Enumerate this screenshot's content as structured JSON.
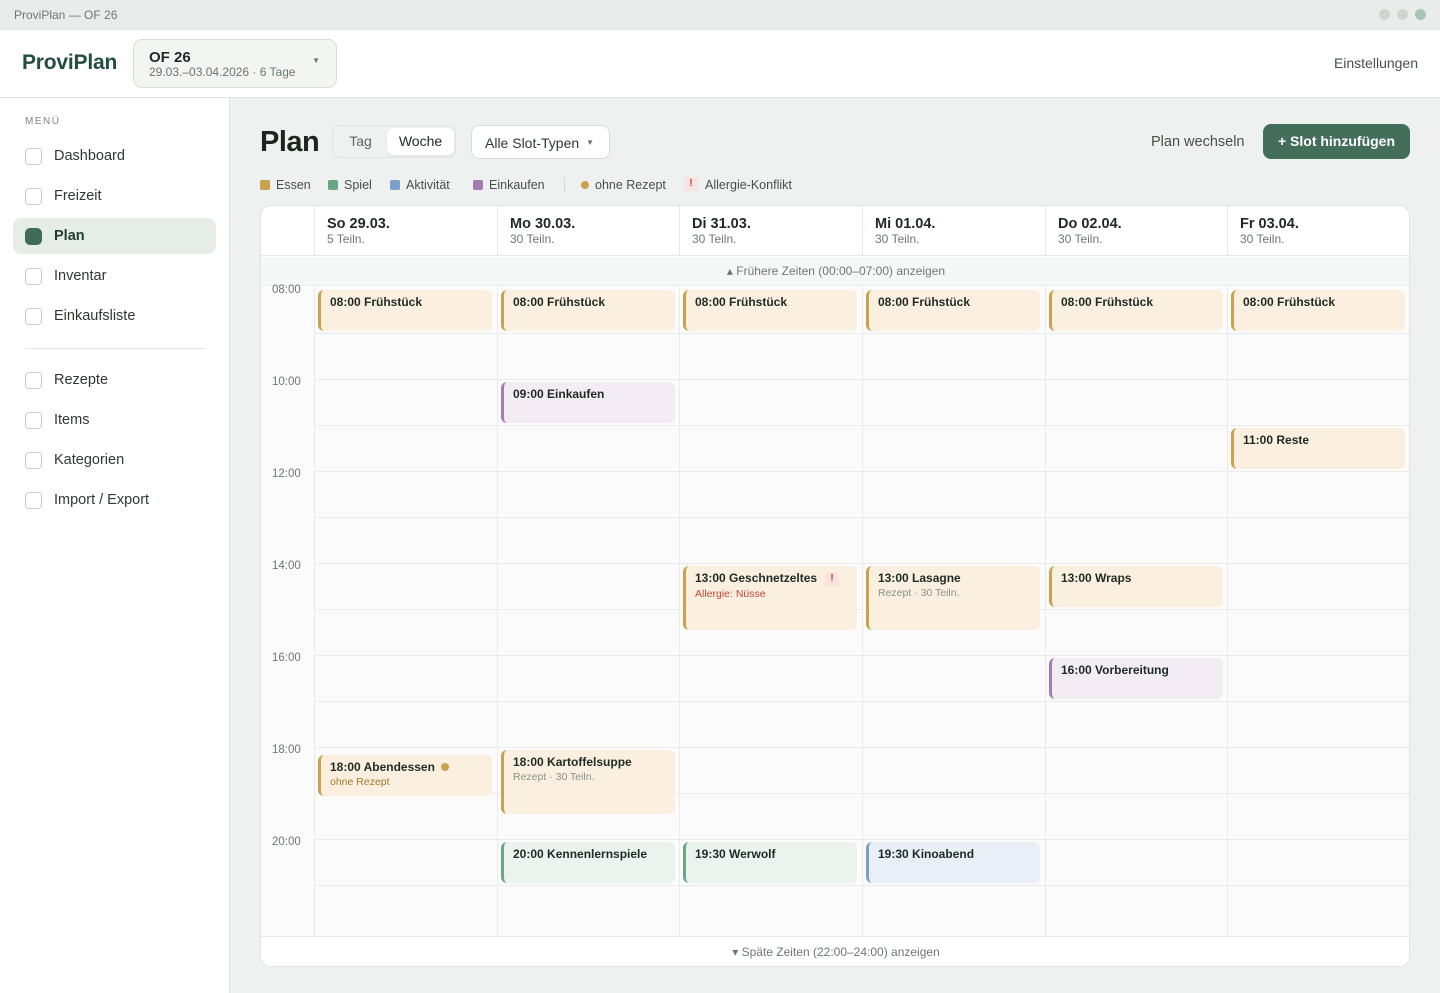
{
  "window": {
    "title": "ProviPlan — OF 26"
  },
  "header": {
    "brand": "ProviPlan",
    "plan_name": "OF 26",
    "plan_subtitle": "29.03.–03.04.2026 · 6 Tage",
    "settings_label": "Einstellungen"
  },
  "sidebar": {
    "menu_label": "MENÜ",
    "items": [
      {
        "label": "Dashboard",
        "active": false
      },
      {
        "label": "Freizeit",
        "active": false
      },
      {
        "label": "Plan",
        "active": true
      },
      {
        "label": "Inventar",
        "active": false
      },
      {
        "label": "Einkaufsliste",
        "active": false
      }
    ],
    "items2": [
      {
        "label": "Rezepte"
      },
      {
        "label": "Items"
      },
      {
        "label": "Kategorien"
      },
      {
        "label": "Import / Export"
      }
    ]
  },
  "toolbar": {
    "title": "Plan",
    "view_day": "Tag",
    "view_week": "Woche",
    "active_view": "Woche",
    "filter_label": "Alle Slot-Typen",
    "switch_label": "Plan wechseln",
    "add_label": "+ Slot hinzufügen"
  },
  "legend": {
    "items": [
      {
        "label": "Essen",
        "color": "#c9a14f"
      },
      {
        "label": "Spiel",
        "color": "#6aa684"
      },
      {
        "label": "Aktivität",
        "color": "#7d9fc9"
      },
      {
        "label": "Einkaufen",
        "color": "#a57bb4"
      }
    ],
    "no_recipe_label": "ohne Rezept",
    "no_recipe_color": "#c9a14f",
    "allergy_label": "Allergie-Konflikt",
    "allergy_icon": "!"
  },
  "calendar": {
    "days": [
      {
        "name": "So 29.03.",
        "participants": "5 Teiln."
      },
      {
        "name": "Mo 30.03.",
        "participants": "30 Teiln."
      },
      {
        "name": "Di 31.03.",
        "participants": "30 Teiln."
      },
      {
        "name": "Mi 01.04.",
        "participants": "30 Teiln."
      },
      {
        "name": "Do 02.04.",
        "participants": "30 Teiln."
      },
      {
        "name": "Fr 03.04.",
        "participants": "30 Teiln."
      }
    ],
    "earlier_label": "▴ Frühere Zeiten (00:00–07:00) anzeigen",
    "later_label": "▾ Späte Zeiten (22:00–24:00) anzeigen",
    "time_labels": [
      "08:00",
      "10:00",
      "12:00",
      "14:00",
      "16:00",
      "18:00",
      "20:00"
    ],
    "events": [
      {
        "day": 0,
        "start": 8,
        "end": 9,
        "type": "essen",
        "title": "08:00 Frühstück"
      },
      {
        "day": 1,
        "start": 8,
        "end": 9,
        "type": "essen",
        "title": "08:00 Frühstück"
      },
      {
        "day": 2,
        "start": 8,
        "end": 9,
        "type": "essen",
        "title": "08:00 Frühstück"
      },
      {
        "day": 3,
        "start": 8,
        "end": 9,
        "type": "essen",
        "title": "08:00 Frühstück"
      },
      {
        "day": 4,
        "start": 8,
        "end": 9,
        "type": "essen",
        "title": "08:00 Frühstück"
      },
      {
        "day": 5,
        "start": 8,
        "end": 9,
        "type": "essen",
        "title": "08:00 Frühstück"
      },
      {
        "day": 1,
        "start": 10,
        "end": 11,
        "type": "einkauf",
        "title": "09:00 Einkaufen"
      },
      {
        "day": 5,
        "start": 11,
        "end": 12,
        "type": "essen",
        "title": "11:00 Reste"
      },
      {
        "day": 2,
        "start": 14,
        "end": 15.5,
        "type": "essen",
        "title": "13:00 Geschnetzeltes",
        "subtitle": "Allergie: Nüsse",
        "allergy": true
      },
      {
        "day": 3,
        "start": 14,
        "end": 15.5,
        "type": "essen",
        "title": "13:00 Lasagne",
        "subtitle": "Rezept · 30 Teiln."
      },
      {
        "day": 4,
        "start": 14,
        "end": 15,
        "type": "essen",
        "title": "13:00 Wraps"
      },
      {
        "day": 4,
        "start": 16,
        "end": 17,
        "type": "einkauf",
        "title": "16:00 Vorbereitung"
      },
      {
        "day": 0,
        "start": 18.1,
        "end": 19.1,
        "type": "essen",
        "title": "18:00 Abendessen",
        "subtitle": "ohne Rezept",
        "no_recipe": true
      },
      {
        "day": 1,
        "start": 18,
        "end": 19.5,
        "type": "essen",
        "title": "18:00 Kartoffelsuppe",
        "subtitle": "Rezept · 30 Teiln."
      },
      {
        "day": 1,
        "start": 20,
        "end": 21,
        "type": "spiel",
        "title": "20:00 Kennenlernspiele"
      },
      {
        "day": 2,
        "start": 20,
        "end": 21,
        "type": "spiel",
        "title": "19:30 Werwolf"
      },
      {
        "day": 3,
        "start": 20,
        "end": 21,
        "type": "aktiv",
        "title": "19:30 Kinoabend"
      }
    ]
  }
}
